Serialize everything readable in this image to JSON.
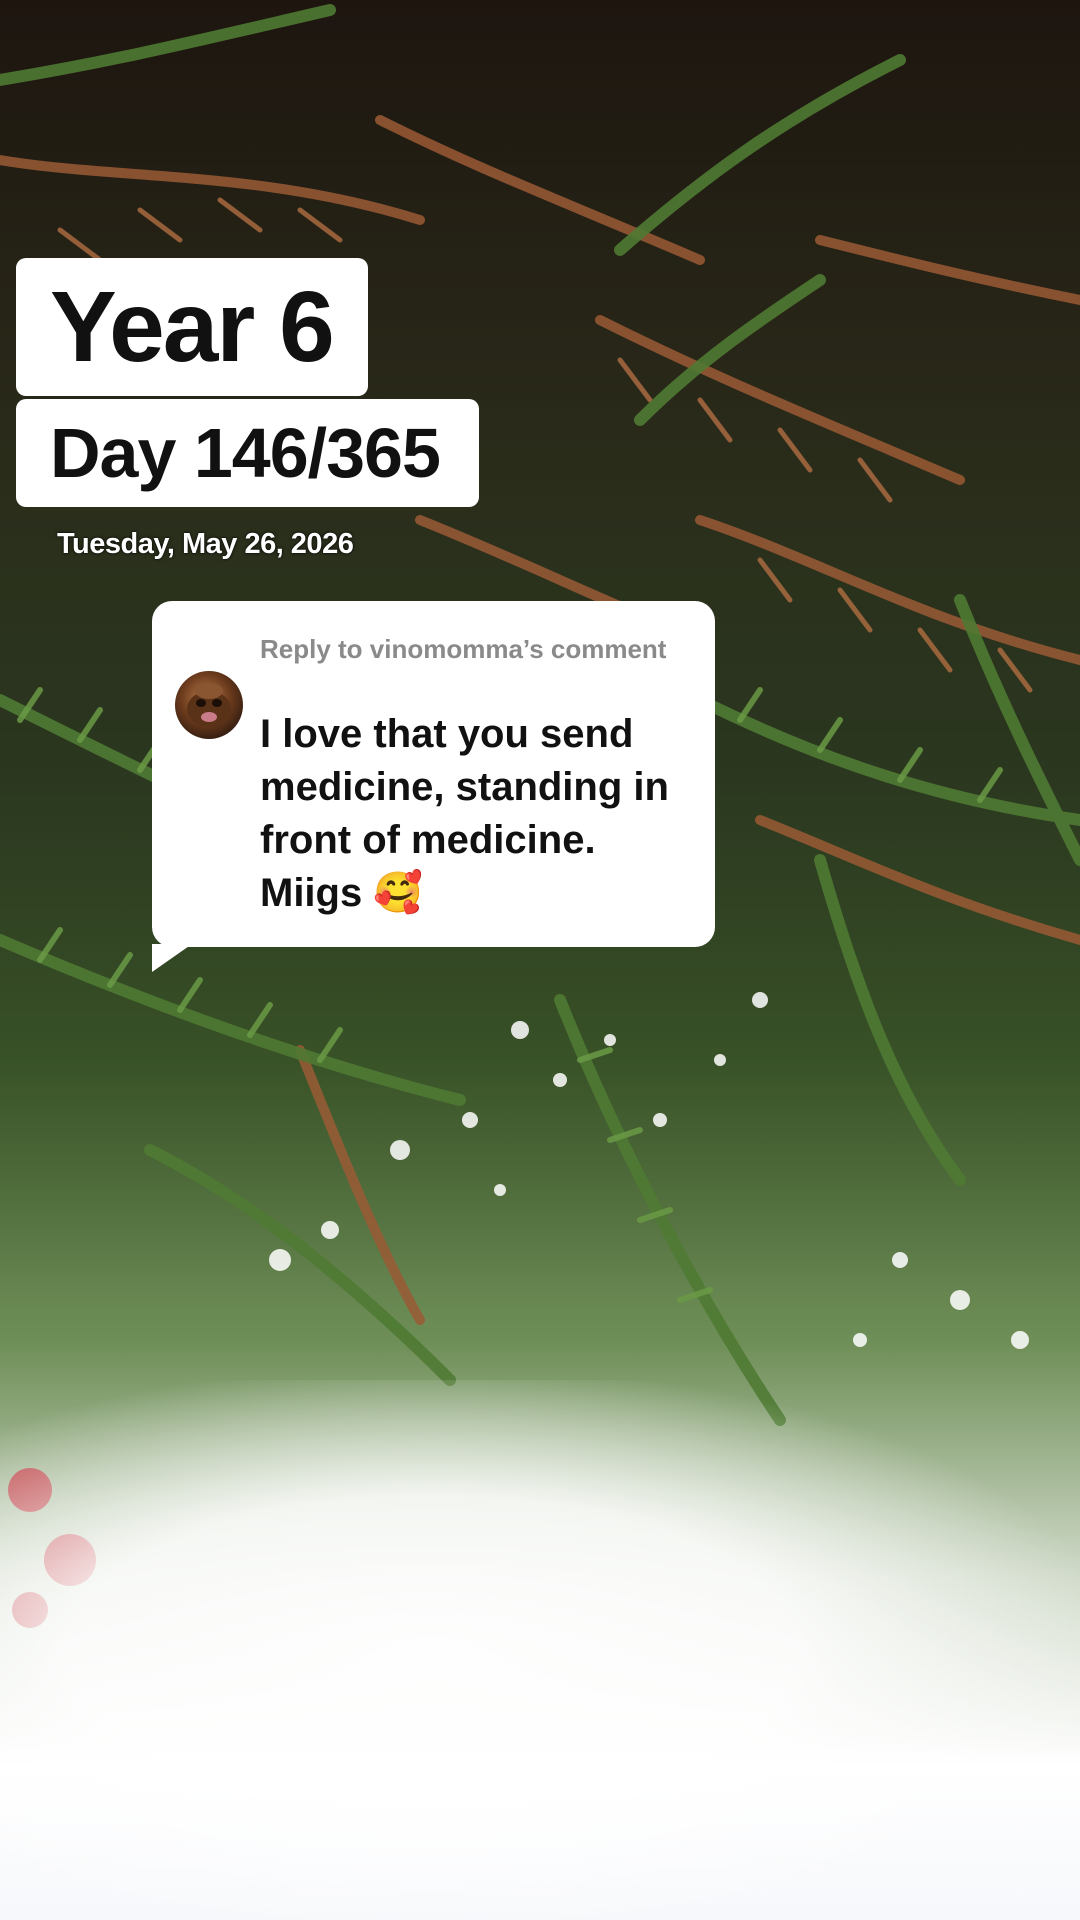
{
  "overlay": {
    "year_label": "Year 6",
    "day_label": "Day 146/365",
    "date_label": "Tuesday, May 26, 2026"
  },
  "comment": {
    "reply_label": "Reply to vinomomma’s comment",
    "text": "I love that you send medicine, standing in front of medicine. Miigs 🥰"
  },
  "colors": {
    "sticker_bg": "#ffffff",
    "sticker_text": "#111111",
    "reply_label": "#8a8a8a"
  },
  "icons": {
    "avatar": "user-avatar"
  }
}
